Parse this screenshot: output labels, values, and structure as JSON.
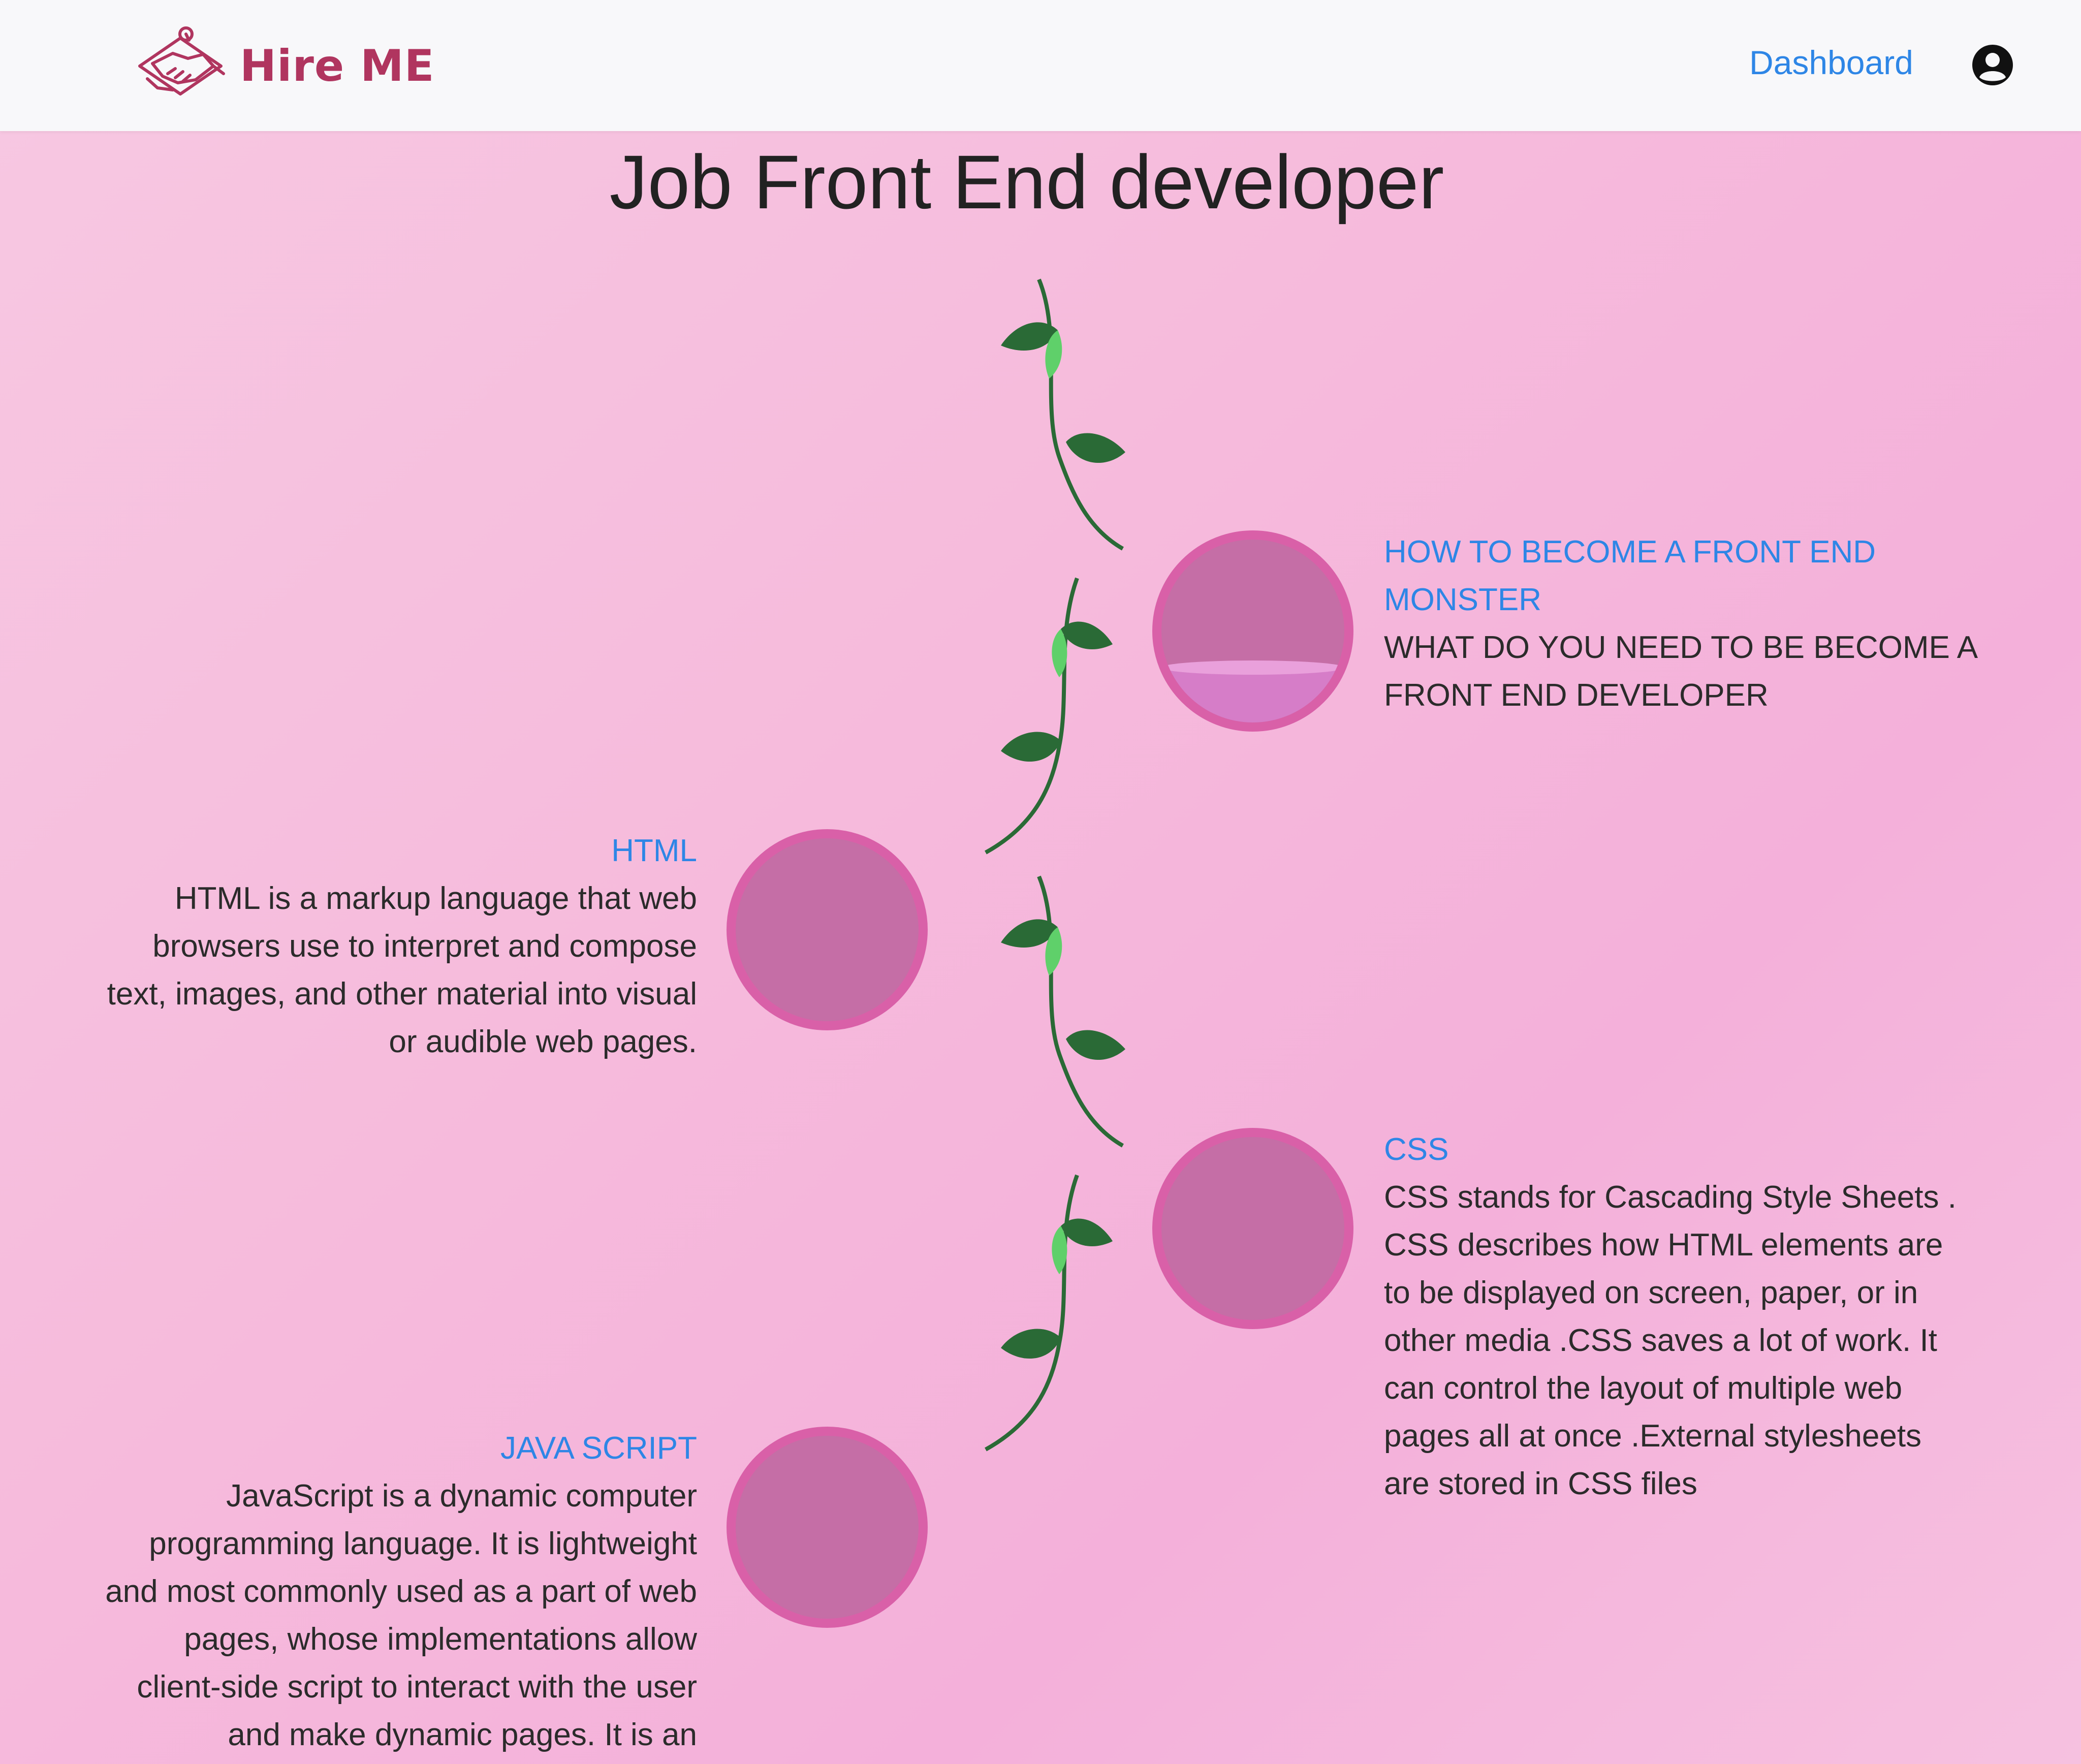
{
  "navbar": {
    "brand": "Hire ME",
    "dashboard_label": "Dashboard",
    "icons": {
      "logo": "handshake-logo",
      "user": "user-circle-icon"
    }
  },
  "page": {
    "title": "Job Front End developer"
  },
  "roadmap": {
    "items": [
      {
        "title": "HOW TO BECOME A FRONT END MONSTER",
        "body": "WHAT DO YOU NEED TO BE BECOME A FRONT END DEVELOPER",
        "side": "right",
        "progress": 0.3
      },
      {
        "title": "HTML",
        "body": "HTML is a markup language that web browsers use to interpret and compose text, images, and other material into visual or audible web pages.",
        "side": "left",
        "progress": 0
      },
      {
        "title": "CSS",
        "body": "CSS stands for Cascading Style Sheets . CSS describes how HTML elements are to be displayed on screen, paper, or in other media .CSS saves a lot of work. It can control the layout of multiple web pages all at once .External stylesheets are stored in CSS files",
        "side": "right",
        "progress": 0
      },
      {
        "title": "JAVA SCRIPT",
        "body": "JavaScript is a dynamic computer programming language. It is lightweight and most commonly used as a part of web pages, whose implementations allow client-side script to interact with the user and make dynamic pages. It is an",
        "side": "left",
        "progress": 0
      }
    ]
  },
  "colors": {
    "accent_link": "#2e86e6",
    "brand": "#b0355f",
    "node_border": "#d960a8",
    "node_fill": "#c56ea6",
    "leaf_dark": "#2a6a36",
    "leaf_light": "#5fd06a"
  }
}
